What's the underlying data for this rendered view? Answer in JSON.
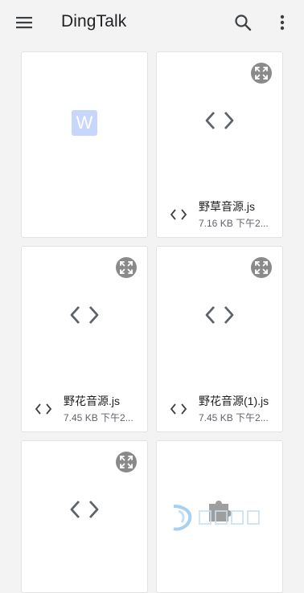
{
  "appbar": {
    "title": "DingTalk",
    "menu_icon": "menu-icon",
    "search_icon": "search-icon",
    "more_icon": "more-vert-icon"
  },
  "files": [
    {
      "name": "",
      "meta": "",
      "preview": "word-doc-icon",
      "preview_text": "W",
      "expandable": false
    },
    {
      "name": "野草音源.js",
      "meta": "7.16 KB 下午2...",
      "preview": "code-icon",
      "expandable": true
    },
    {
      "name": "野花音源.js",
      "meta": "7.45 KB 下午2...",
      "preview": "code-icon",
      "expandable": true
    },
    {
      "name": "野花音源(1).js",
      "meta": "7.45 KB 下午2...",
      "preview": "code-icon",
      "expandable": true
    },
    {
      "name": "",
      "meta": "",
      "preview": "code-icon",
      "expandable": true
    },
    {
      "name": "",
      "meta": "",
      "preview": "puzzle-icon",
      "expandable": false
    }
  ],
  "colors": {
    "background": "#f3f3f3",
    "card": "#ffffff",
    "icon": "#5f6368",
    "word_badge": "#c7d6fb"
  }
}
